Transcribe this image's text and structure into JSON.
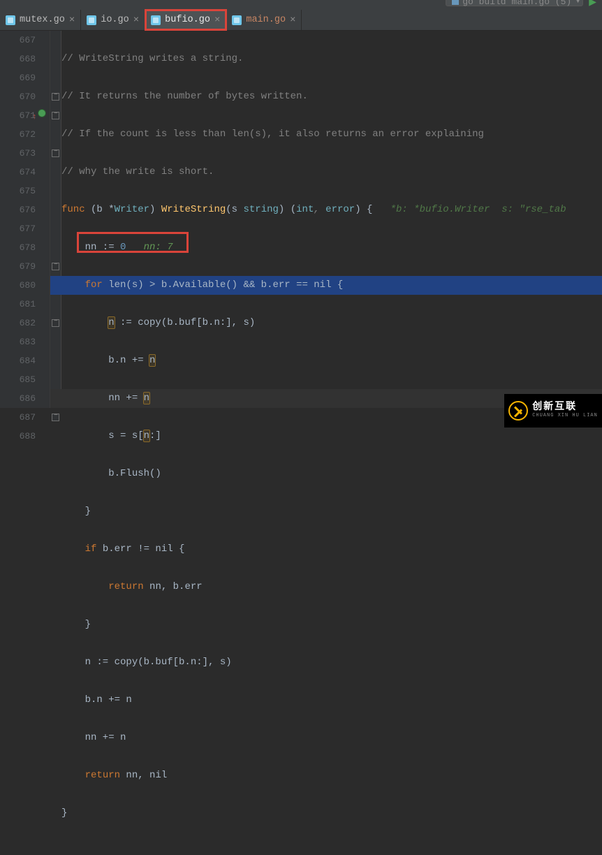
{
  "toolbar": {
    "build_label": "go build main.go (5)",
    "run_icon": "play-icon"
  },
  "tabs": [
    {
      "name": "mutex.go",
      "active": false,
      "icon": "go-file-icon"
    },
    {
      "name": "io.go",
      "active": false,
      "icon": "go-file-icon"
    },
    {
      "name": "bufio.go",
      "active": true,
      "icon": "go-file-icon"
    },
    {
      "name": "main.go",
      "active": false,
      "icon": "go-file-icon"
    }
  ],
  "highlighted_tab_index": 2,
  "gutter": {
    "start": 667,
    "lines": [
      667,
      668,
      669,
      670,
      671,
      672,
      673,
      674,
      675,
      676,
      677,
      678,
      679,
      680,
      681,
      682,
      683,
      684,
      685,
      686,
      687,
      688
    ],
    "breakpoint_line": 671,
    "folds": [
      670,
      671,
      673,
      679,
      680,
      682,
      687
    ]
  },
  "code": {
    "l667": "// WriteString writes a string.",
    "l668": "// It returns the number of bytes written.",
    "l669": "// If the count is less than len(s), it also returns an error explaining",
    "l670": "// why the write is short.",
    "l671_kw": "func",
    "l671_recv": " (b *",
    "l671_ty1": "Writer",
    "l671_paren": ") ",
    "l671_fn": "WriteString",
    "l671_sig1": "(s ",
    "l671_ty2": "string",
    "l671_sig2": ") (",
    "l671_ty3": "int",
    "l671_comma": ", ",
    "l671_ty4": "error",
    "l671_sig3": ") {",
    "l671_hint": "   *b: *bufio.Writer  s: \"rse_tab",
    "l672_txt": "    nn := ",
    "l672_num": "0",
    "l672_hint": "   nn: 7",
    "l673_for": "for",
    "l673_txt": " len(s) > b.Available() && b.err == nil {",
    "l674_pre": "        ",
    "l674_n": "n",
    "l674_rest": " := copy(b.buf[b.n:], s)",
    "l675_pre": "        b.n += ",
    "l675_n": "n",
    "l676_pre": "        nn += ",
    "l676_n": "n",
    "l677_pre": "        s = s[",
    "l677_n": "n",
    "l677_rest": ":]",
    "l678": "        b.Flush()",
    "l679": "    }",
    "l680_if": "if",
    "l680_txt": " b.err != nil {",
    "l681_ret": "return",
    "l681_txt": " nn, b.err",
    "l682": "    }",
    "l683": "    n := copy(b.buf[b.n:], s)",
    "l684": "    b.n += n",
    "l685": "    nn += n",
    "l686_ret": "return",
    "l686_txt": " nn, nil",
    "l687": "}",
    "l688": ""
  },
  "watermark": {
    "cn": "创新互联",
    "en": "CHUANG XIN HU LIAN"
  },
  "colors": {
    "bg": "#2b2b2b",
    "keyword": "#cc7832",
    "func": "#ffc66d",
    "type": "#6fafbd",
    "number": "#6897bb",
    "comment": "#808080",
    "selection": "#214283",
    "red_highlight": "#d9443a"
  }
}
